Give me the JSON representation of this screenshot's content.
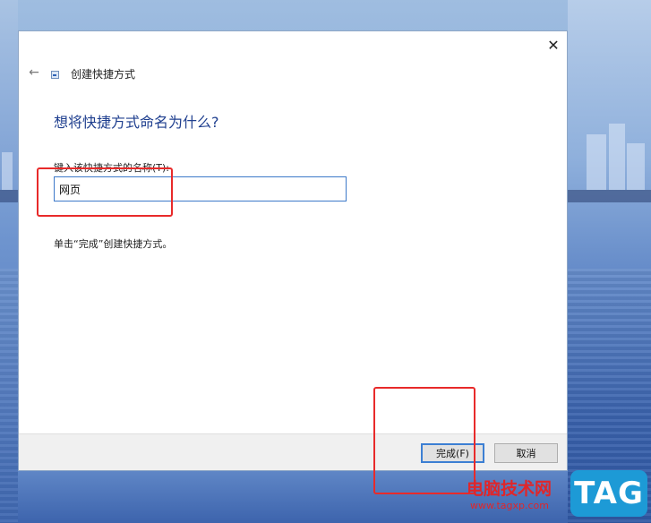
{
  "window": {
    "title": "创建快捷方式",
    "close_glyph": "✕",
    "back_glyph": "←"
  },
  "page": {
    "heading": "想将快捷方式命名为什么?",
    "field_label": "键入该快捷方式的名称(T):",
    "field_value": "网页",
    "hint": "单击“完成”创建快捷方式。"
  },
  "buttons": {
    "finish": "完成(F)",
    "cancel": "取消"
  },
  "watermark": {
    "site": "电脑技术网",
    "url": "www.tagxp.com",
    "badge": "TAG"
  },
  "colors": {
    "heading": "#1f3f8f",
    "focus_border": "#3c7fd3",
    "annotation": "#e82a2a",
    "watermark_red": "#e0262a",
    "badge_blue": "#1d9ad6"
  },
  "icons": {
    "close": "close-icon",
    "back": "back-arrow-icon",
    "title": "shortcut-icon"
  }
}
